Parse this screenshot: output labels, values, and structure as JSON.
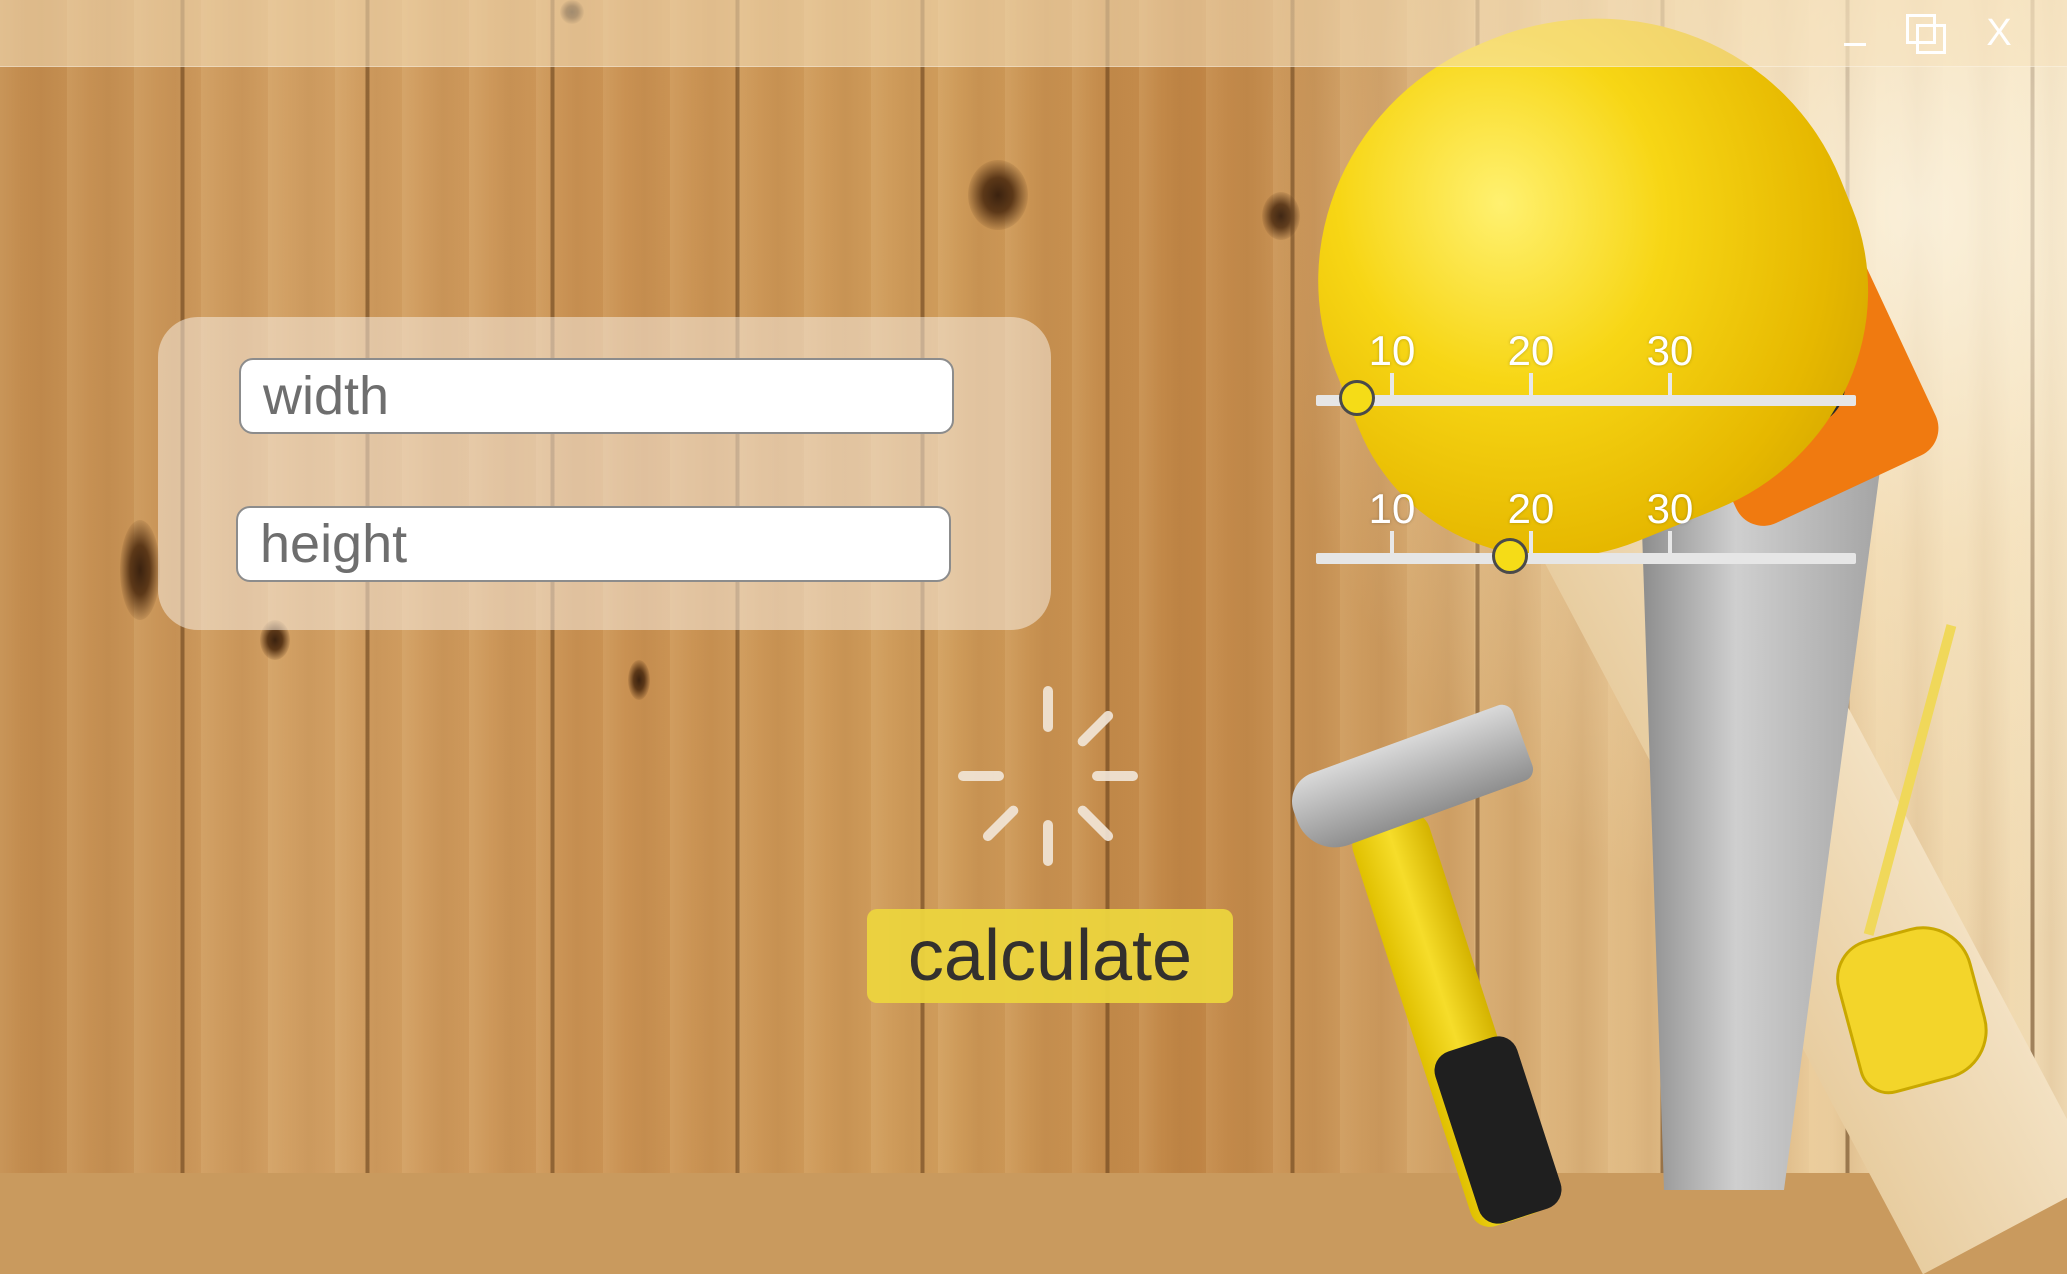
{
  "window": {
    "minimize_label": "_",
    "close_label": "X"
  },
  "form": {
    "width_placeholder": "width",
    "height_placeholder": "height"
  },
  "sliders": [
    {
      "tick_labels": [
        "10",
        "20",
        "30"
      ],
      "ticks": [
        10,
        20,
        30
      ],
      "value": 7.5
    },
    {
      "tick_labels": [
        "10",
        "20",
        "30"
      ],
      "ticks": [
        10,
        20,
        30
      ],
      "value": 18.5
    }
  ],
  "actions": {
    "calculate_label": "calculate"
  },
  "colors": {
    "accent_yellow": "#ecd43e",
    "thumb_yellow": "#f5dc17"
  },
  "icons": {
    "loading": "loading-spinner-icon",
    "maximize": "restore-window-icon"
  }
}
